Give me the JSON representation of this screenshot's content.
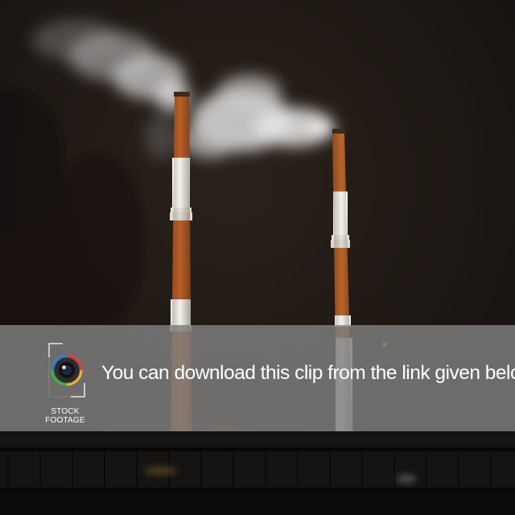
{
  "overlay": {
    "message": "You can download this clip from the link given below.",
    "logo_label": "STOCK FOOTAGE",
    "logo_icon": "camera-lens-icon"
  },
  "scene": {
    "subject": "chimneys"
  },
  "colors": {
    "banner": "#808080",
    "banner_text": "#ffffff",
    "sky": "#1c1612",
    "stack_orange": "#c8682a",
    "stack_white": "#f4f1ea"
  }
}
